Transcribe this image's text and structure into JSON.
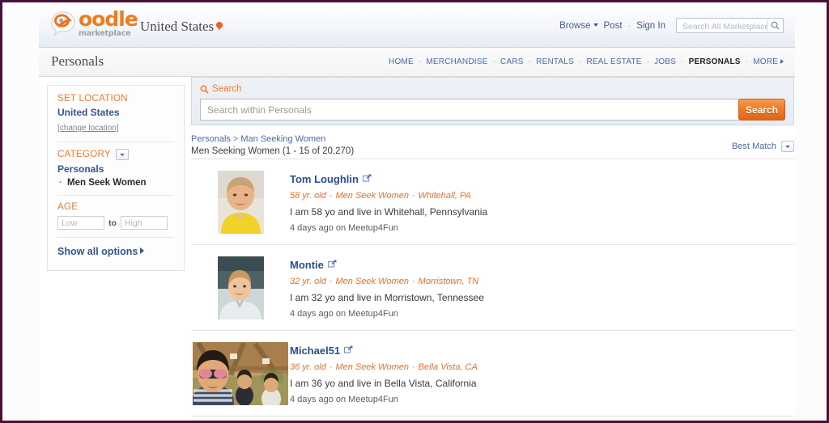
{
  "header": {
    "logo_name": "oodle",
    "logo_tagline": "marketplace",
    "location": "United States",
    "location_pin_icon": "map-pin-icon",
    "nav": [
      {
        "label": "Browse",
        "has_caret": true
      },
      {
        "label": "Post",
        "has_caret": false
      },
      {
        "label": "Sign In",
        "has_caret": false
      }
    ],
    "search": {
      "placeholder": "Search All Marketplace",
      "value": "",
      "icon": "search-icon"
    }
  },
  "category_bar": {
    "title": "Personals",
    "items": [
      {
        "label": "HOME",
        "active": false
      },
      {
        "label": "MERCHANDISE",
        "active": false
      },
      {
        "label": "CARS",
        "active": false
      },
      {
        "label": "RENTALS",
        "active": false
      },
      {
        "label": "REAL ESTATE",
        "active": false
      },
      {
        "label": "JOBS",
        "active": false
      },
      {
        "label": "PERSONALS",
        "active": true
      },
      {
        "label": "MORE",
        "active": false
      }
    ]
  },
  "sidebar": {
    "set_location_heading": "SET LOCATION",
    "location_value": "United States",
    "change_location_link": "[change location]",
    "category_heading": "CATEGORY",
    "category_dropdown_icon": "chevron-down-icon",
    "category_value": "Personals",
    "selected_subcategory": "Men Seek Women",
    "age_heading": "AGE",
    "age_low_placeholder": "Low",
    "age_low_value": "",
    "age_to_label": "to",
    "age_high_placeholder": "High",
    "age_high_value": "",
    "show_all_options": "Show all options"
  },
  "search_panel": {
    "label": "Search",
    "icon": "search-icon",
    "placeholder": "Search within Personals",
    "value": "",
    "button_label": "Search"
  },
  "results": {
    "breadcrumb": [
      "Personals",
      "Man Seeking Women"
    ],
    "breadcrumb_separator": ">",
    "count_line": "Men Seeking Women (1 - 15 of 20,270)",
    "sort_label": "Best Match",
    "sort_icon": "chevron-down-icon",
    "listings": [
      {
        "name": "Tom Loughlin",
        "external_icon": "external-link-icon",
        "age": "58 yr. old",
        "category": "Men Seek Women",
        "location": "Whitehall, PA",
        "description": "I am 58 yo and live in Whitehall, Pennsylvania",
        "posted": "4 days ago on Meetup4Fun",
        "thumb_shape": "portrait"
      },
      {
        "name": "Montie",
        "external_icon": "external-link-icon",
        "age": "32 yr. old",
        "category": "Men Seek Women",
        "location": "Morristown, TN",
        "description": "I am 32 yo and live in Morristown, Tennessee",
        "posted": "4 days ago on Meetup4Fun",
        "thumb_shape": "portrait"
      },
      {
        "name": "Michael51",
        "external_icon": "external-link-icon",
        "age": "36 yr. old",
        "category": "Men Seek Women",
        "location": "Bella Vista, CA",
        "description": "I am 36 yo and live in Bella Vista, California",
        "posted": "4 days ago on Meetup4Fun",
        "thumb_shape": "wide"
      }
    ]
  },
  "colors": {
    "brand_orange": "#ef7a26",
    "link_blue": "#2b4f8e",
    "meta_orange": "#e8702a",
    "frame_border": "#4a1138"
  }
}
